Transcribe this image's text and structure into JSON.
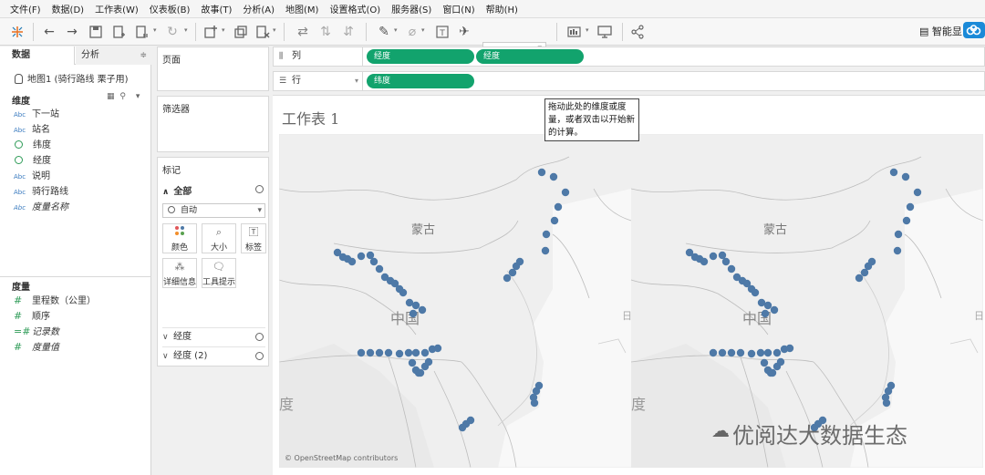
{
  "menu": [
    "文件(F)",
    "数据(D)",
    "工作表(W)",
    "仪表板(B)",
    "故事(T)",
    "分析(A)",
    "地图(M)",
    "设置格式(O)",
    "服务器(S)",
    "窗口(N)",
    "帮助(H)"
  ],
  "toolbar": {
    "smart_label": "智能显"
  },
  "data_pane": {
    "tabs": [
      "数据",
      "分析"
    ],
    "datasource": "地图1 (骑行路线 栗子用)",
    "dimensions_title": "维度",
    "dimensions": [
      {
        "type": "Abc",
        "name": "下一站"
      },
      {
        "type": "Abc",
        "name": "站名"
      },
      {
        "type": "geo",
        "name": "纬度"
      },
      {
        "type": "geo",
        "name": "经度"
      },
      {
        "type": "Abc",
        "name": "说明"
      },
      {
        "type": "Abc",
        "name": "骑行路线"
      },
      {
        "type": "Abc",
        "name": "度量名称"
      }
    ],
    "measures_title": "度量",
    "measures": [
      {
        "type": "#",
        "name": "里程数（公里）"
      },
      {
        "type": "#",
        "name": "顺序"
      },
      {
        "type": "=#",
        "name": "记录数"
      },
      {
        "type": "#",
        "name": "度量值"
      }
    ]
  },
  "cards": {
    "pages": "页面",
    "filters": "筛选器",
    "marks": "标记",
    "marks_all": "全部",
    "mark_type": "自动",
    "buttons": [
      "颜色",
      "大小",
      "标签",
      "详细信息",
      "工具提示"
    ],
    "rows": [
      "经度",
      "经度 (2)"
    ]
  },
  "shelves": {
    "columns_label": "列",
    "columns_pills": [
      "经度",
      "经度"
    ],
    "rows_label": "行",
    "rows_pills": [
      "纬度"
    ]
  },
  "sheet": {
    "title": "工作表 1",
    "tooltip": "拖动此处的维度或度量，或者双击以开始新的计算。",
    "map_labels": {
      "mongolia": "蒙古",
      "china": "中国",
      "india": "度",
      "japan": "日"
    },
    "attribution": "© OpenStreetMap contributors",
    "watermark": "优阅达大数据生态"
  },
  "colors": {
    "pill": "#12a36d",
    "point": "#4e79a7",
    "land": "#ebebeb",
    "sea": "#f7f7f7"
  }
}
